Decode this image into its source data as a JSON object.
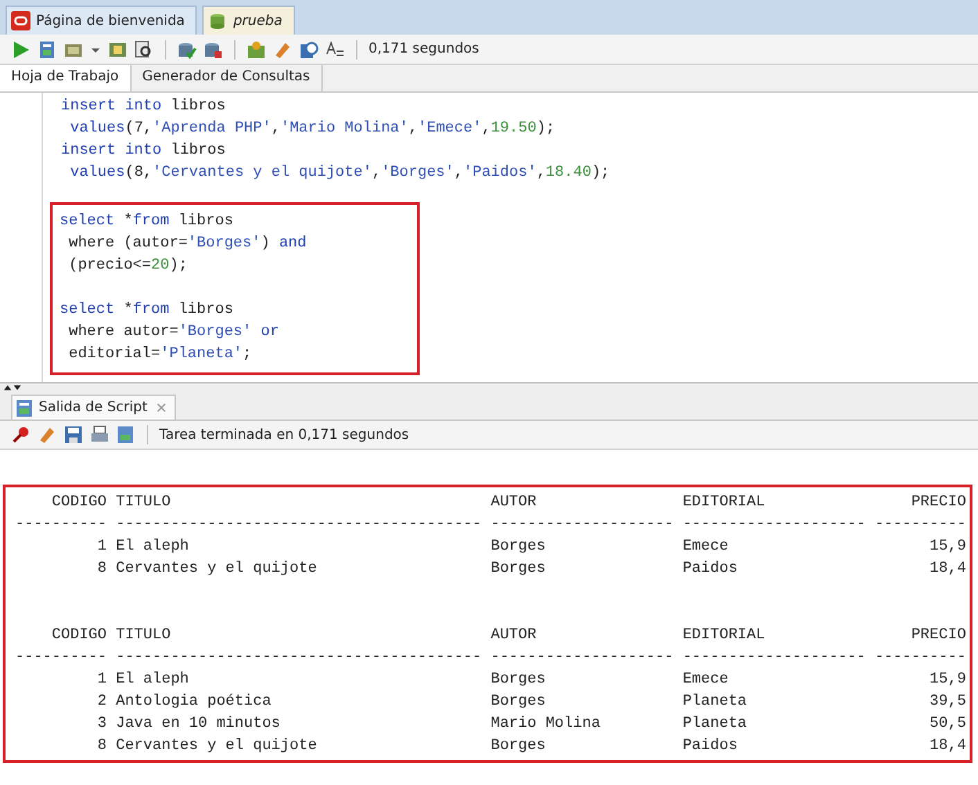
{
  "doc_tabs": [
    {
      "label": "Página de bienvenida",
      "kind": "welcome",
      "selected": false
    },
    {
      "label": "prueba",
      "kind": "worksheet",
      "selected": true
    }
  ],
  "toolbar": {
    "timing": "0,171 segundos"
  },
  "sub_tabs": [
    {
      "label": "Hoja de Trabajo",
      "selected": true
    },
    {
      "label": "Generador de Consultas",
      "selected": false
    }
  ],
  "editor": {
    "sections": [
      {
        "highlighted": false,
        "statements": [
          {
            "lines": [
              [
                {
                  "text": "insert into",
                  "kind": "kw"
                },
                {
                  "text": " libros",
                  "kind": "p"
                }
              ],
              [
                {
                  "text": " values",
                  "kind": "kw"
                },
                {
                  "text": "(7,",
                  "kind": "p"
                },
                {
                  "text": "'Aprenda PHP'",
                  "kind": "str"
                },
                {
                  "text": ",",
                  "kind": "p"
                },
                {
                  "text": "'Mario Molina'",
                  "kind": "str"
                },
                {
                  "text": ",",
                  "kind": "p"
                },
                {
                  "text": "'Emece'",
                  "kind": "str"
                },
                {
                  "text": ",",
                  "kind": "p"
                },
                {
                  "text": "19.50",
                  "kind": "num"
                },
                {
                  "text": ");",
                  "kind": "p"
                }
              ],
              [
                {
                  "text": "insert into",
                  "kind": "kw"
                },
                {
                  "text": " libros",
                  "kind": "p"
                }
              ],
              [
                {
                  "text": " values",
                  "kind": "kw"
                },
                {
                  "text": "(8,",
                  "kind": "p"
                },
                {
                  "text": "'Cervantes y el quijote'",
                  "kind": "str"
                },
                {
                  "text": ",",
                  "kind": "p"
                },
                {
                  "text": "'Borges'",
                  "kind": "str"
                },
                {
                  "text": ",",
                  "kind": "p"
                },
                {
                  "text": "'Paidos'",
                  "kind": "str"
                },
                {
                  "text": ",",
                  "kind": "p"
                },
                {
                  "text": "18.40",
                  "kind": "num"
                },
                {
                  "text": ");",
                  "kind": "p"
                }
              ]
            ]
          }
        ]
      },
      {
        "highlighted": true,
        "statements": [
          {
            "lines": [
              [
                {
                  "text": "select",
                  "kind": "kw"
                },
                {
                  "text": " *",
                  "kind": "p"
                },
                {
                  "text": "from",
                  "kind": "kw"
                },
                {
                  "text": " libros",
                  "kind": "p"
                }
              ],
              [
                {
                  "text": " where (autor=",
                  "kind": "p"
                },
                {
                  "text": "'Borges'",
                  "kind": "str"
                },
                {
                  "text": ") ",
                  "kind": "p"
                },
                {
                  "text": "and",
                  "kind": "kw"
                }
              ],
              [
                {
                  "text": " (precio<=",
                  "kind": "p"
                },
                {
                  "text": "20",
                  "kind": "num"
                },
                {
                  "text": ");",
                  "kind": "p"
                }
              ]
            ]
          },
          {
            "lines": [
              [
                {
                  "text": "select",
                  "kind": "kw"
                },
                {
                  "text": " *",
                  "kind": "p"
                },
                {
                  "text": "from",
                  "kind": "kw"
                },
                {
                  "text": " libros",
                  "kind": "p"
                }
              ],
              [
                {
                  "text": " where autor=",
                  "kind": "p"
                },
                {
                  "text": "'Borges'",
                  "kind": "str"
                },
                {
                  "text": " or",
                  "kind": "kw"
                }
              ],
              [
                {
                  "text": " editorial=",
                  "kind": "p"
                },
                {
                  "text": "'Planeta'",
                  "kind": "str"
                },
                {
                  "text": ";",
                  "kind": "p"
                }
              ]
            ]
          }
        ]
      }
    ]
  },
  "output": {
    "tab": "Salida de Script",
    "status": "Tarea terminada en 0,171 segundos",
    "results": [
      {
        "headers": [
          "CODIGO",
          "TITULO",
          "AUTOR",
          "EDITORIAL",
          "PRECIO"
        ],
        "separators": [
          "----------",
          "----------------------------------------",
          "--------------------",
          "--------------------",
          "----------"
        ],
        "rows": [
          [
            "1",
            "El aleph",
            "Borges",
            "Emece",
            "15,9"
          ],
          [
            "8",
            "Cervantes y el quijote",
            "Borges",
            "Paidos",
            "18,4"
          ]
        ]
      },
      {
        "headers": [
          "CODIGO",
          "TITULO",
          "AUTOR",
          "EDITORIAL",
          "PRECIO"
        ],
        "separators": [
          "----------",
          "----------------------------------------",
          "--------------------",
          "--------------------",
          "----------"
        ],
        "rows": [
          [
            "1",
            "El aleph",
            "Borges",
            "Emece",
            "15,9"
          ],
          [
            "2",
            "Antologia poética",
            "Borges",
            "Planeta",
            "39,5"
          ],
          [
            "3",
            "Java en 10 minutos",
            "Mario Molina",
            "Planeta",
            "50,5"
          ],
          [
            "8",
            "Cervantes y el quijote",
            "Borges",
            "Paidos",
            "18,4"
          ]
        ]
      }
    ]
  }
}
